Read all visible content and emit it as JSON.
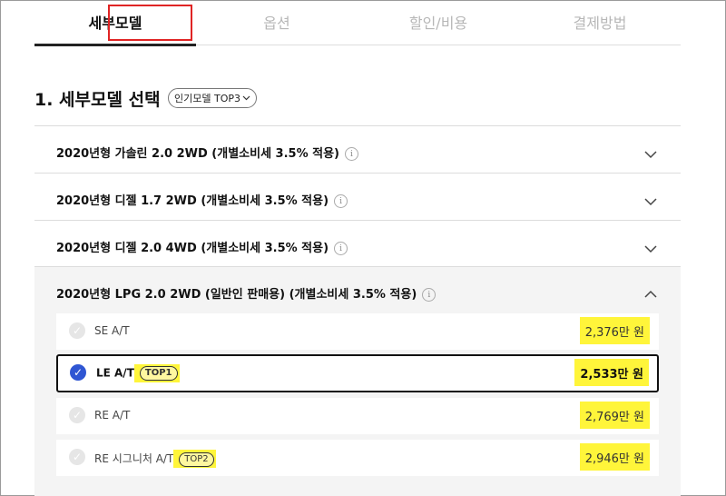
{
  "tabs": [
    {
      "label": "세부모델",
      "active": true
    },
    {
      "label": "옵션",
      "active": false
    },
    {
      "label": "할인/비용",
      "active": false
    },
    {
      "label": "결제방법",
      "active": false
    }
  ],
  "section": {
    "title": "1. 세부모델 선택",
    "popular_button": "인기모델 TOP3"
  },
  "accordion": [
    {
      "label": "2020년형 가솔린 2.0 2WD (개별소비세 3.5% 적용)",
      "expanded": false
    },
    {
      "label": "2020년형 디젤 1.7 2WD (개별소비세 3.5% 적용)",
      "expanded": false
    },
    {
      "label": "2020년형 디젤 2.0 4WD (개별소비세 3.5% 적용)",
      "expanded": false
    },
    {
      "label": "2020년형 LPG 2.0 2WD (일반인 판매용) (개별소비세 3.5% 적용)",
      "expanded": true
    }
  ],
  "options": [
    {
      "name": "SE A/T",
      "badge": "",
      "price": "2,376만 원",
      "selected": false
    },
    {
      "name": "LE A/T",
      "badge": "TOP1",
      "price": "2,533만 원",
      "selected": true
    },
    {
      "name": "RE A/T",
      "badge": "",
      "price": "2,769만 원",
      "selected": false
    },
    {
      "name": "RE 시그니처 A/T",
      "badge": "TOP2",
      "price": "2,946만 원",
      "selected": false
    }
  ],
  "colors": {
    "highlight": "#fff53a",
    "annotation_border": "#e02424",
    "check_selected": "#2f56d3"
  }
}
